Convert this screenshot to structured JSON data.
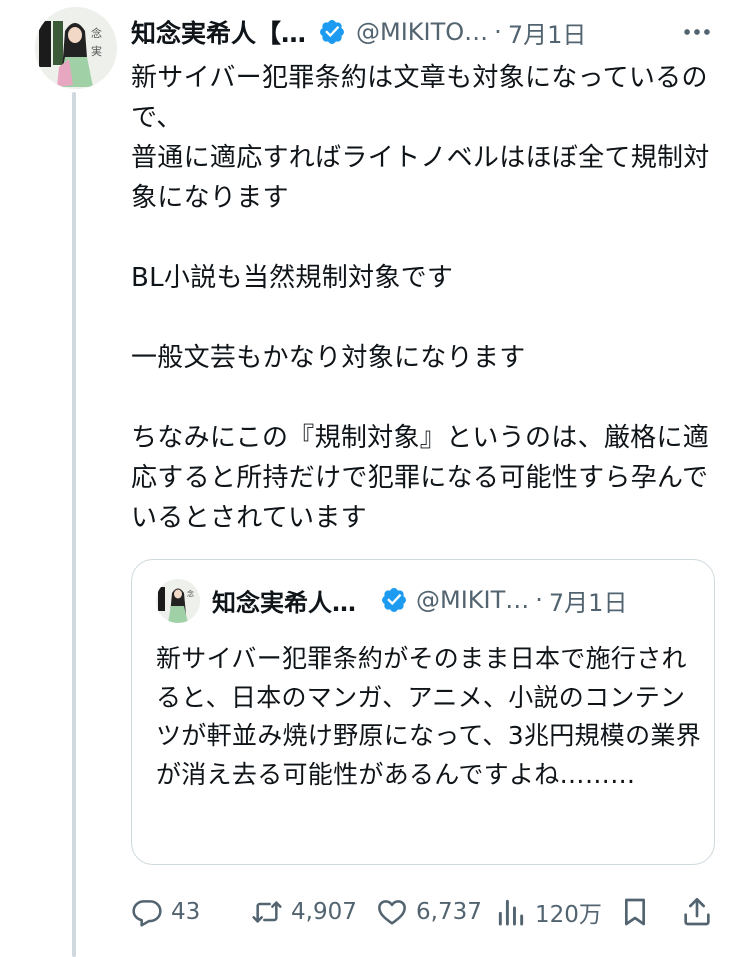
{
  "tweet": {
    "author": {
      "display_name": "知念実希人【…",
      "handle": "@MIKITO…",
      "avatar_text": "念 実 希"
    },
    "separator": "·",
    "date": "7月1日",
    "body": "新サイバー犯罪条約は文章も対象になっているので、\n普通に適応すればライトノベルはほぼ全て規制対象になります\n\nBL小説も当然規制対象です\n\n一般文芸もかなり対象になります\n\nちなみにこの『規制対象』というのは、厳格に適応すると所持だけで犯罪になる可能性すら孕んでいるとされています",
    "quoted": {
      "display_name": "知念実希人…",
      "handle": "@MIKIT…",
      "separator": "·",
      "date": "7月1日",
      "body": "新サイバー犯罪条約がそのまま日本で施行されると、日本のマンガ、アニメ、小説のコンテンツが軒並み焼け野原になって、3兆円規模の業界が消え去る可能性があるんですよね………"
    },
    "actions": {
      "replies": "43",
      "retweets": "4,907",
      "likes": "6,737",
      "views": "120万"
    },
    "colors": {
      "text": "#0f1419",
      "muted": "#536471",
      "verified": "#1d9bf0",
      "thread_line": "#cfd9de"
    },
    "icons": [
      "verified-badge-icon",
      "more-icon",
      "reply-icon",
      "retweet-icon",
      "like-icon",
      "views-icon",
      "bookmark-icon",
      "share-icon"
    ]
  }
}
